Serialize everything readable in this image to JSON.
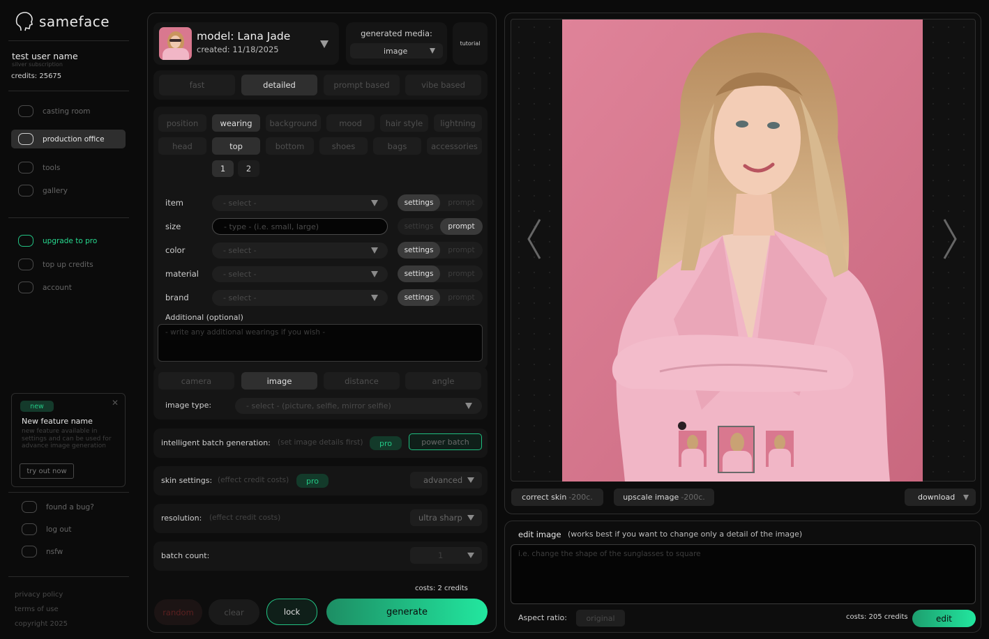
{
  "app": {
    "name": "sameface"
  },
  "user": {
    "name": "test user name",
    "subscription": "silver subscription",
    "credits": "credits: 25675"
  },
  "nav": {
    "main": [
      "casting room",
      "production office",
      "tools",
      "gallery"
    ],
    "account": [
      "upgrade to pro",
      "top up credits",
      "account"
    ],
    "bottom": [
      "found a bug?",
      "log out",
      "nsfw"
    ]
  },
  "feature": {
    "badge": "new",
    "title": "New feature name",
    "desc": "new feature available in settings and can be used for advance image generation",
    "cta": "try out now"
  },
  "footer": {
    "privacy": "privacy policy",
    "terms": "terms of use",
    "copyright": "copyright 2025"
  },
  "model": {
    "name": "model: Lana Jade",
    "created": "created: 11/18/2025"
  },
  "media": {
    "label": "generated media:",
    "value": "image"
  },
  "tutorial": "tutorial",
  "modes": [
    "fast",
    "detailed",
    "prompt based",
    "vibe based"
  ],
  "categories_row1": [
    "position",
    "wearing",
    "background",
    "mood",
    "hair style",
    "lightning"
  ],
  "categories_row2": [
    "head",
    "top",
    "bottom",
    "shoes",
    "bags",
    "accessories"
  ],
  "pages": [
    "1",
    "2"
  ],
  "fields": [
    {
      "label": "item",
      "placeholder": "- select -",
      "mode": "settings"
    },
    {
      "label": "size",
      "placeholder": "- type - (i.e. small, large)",
      "mode": "prompt"
    },
    {
      "label": "color",
      "placeholder": "- select -",
      "mode": "settings"
    },
    {
      "label": "material",
      "placeholder": "- select -",
      "mode": "settings"
    },
    {
      "label": "brand",
      "placeholder": "- select -",
      "mode": "settings"
    }
  ],
  "seg_labels": {
    "settings": "settings",
    "prompt": "prompt"
  },
  "additional": {
    "label": "Additional (optional)",
    "placeholder": "- write any additional wearings if you wish -"
  },
  "image_tabs": [
    "camera",
    "image",
    "distance",
    "angle"
  ],
  "image_type": {
    "label": "image type:",
    "placeholder": "- select - (picture, selfie, mirror selfie)"
  },
  "batch": {
    "label": "intelligent batch generation:",
    "hint": "(set image details first)",
    "pro": "pro",
    "button": "power batch"
  },
  "skin": {
    "label": "skin settings:",
    "hint": "(effect credit costs)",
    "pro": "pro",
    "value": "advanced"
  },
  "resolution": {
    "label": "resolution:",
    "hint": "(effect credit costs)",
    "value": "ultra sharp"
  },
  "batch_count": {
    "label": "batch count:",
    "value": "1"
  },
  "costs": "costs: 2 credits",
  "actions": {
    "random": "random",
    "clear": "clear",
    "lock": "lock",
    "generate": "generate"
  },
  "preview": {
    "correct_skin": "correct skin",
    "correct_skin_cost": "-200c.",
    "upscale": "upscale image",
    "upscale_cost": "-200c.",
    "download": "download"
  },
  "edit": {
    "title": "edit image",
    "hint": "(works best if you want to change only a detail of the image)",
    "placeholder": "i.e. change the shape of the sunglasses to square",
    "aspect_label": "Aspect ratio:",
    "aspect_value": "original",
    "costs": "costs: 205 credits",
    "button": "edit"
  },
  "colors": {
    "accent": "#1fe39a",
    "accent_dark": "#133a2a",
    "photo_bg": "#d9788f",
    "coat": "#f1b6c6"
  }
}
